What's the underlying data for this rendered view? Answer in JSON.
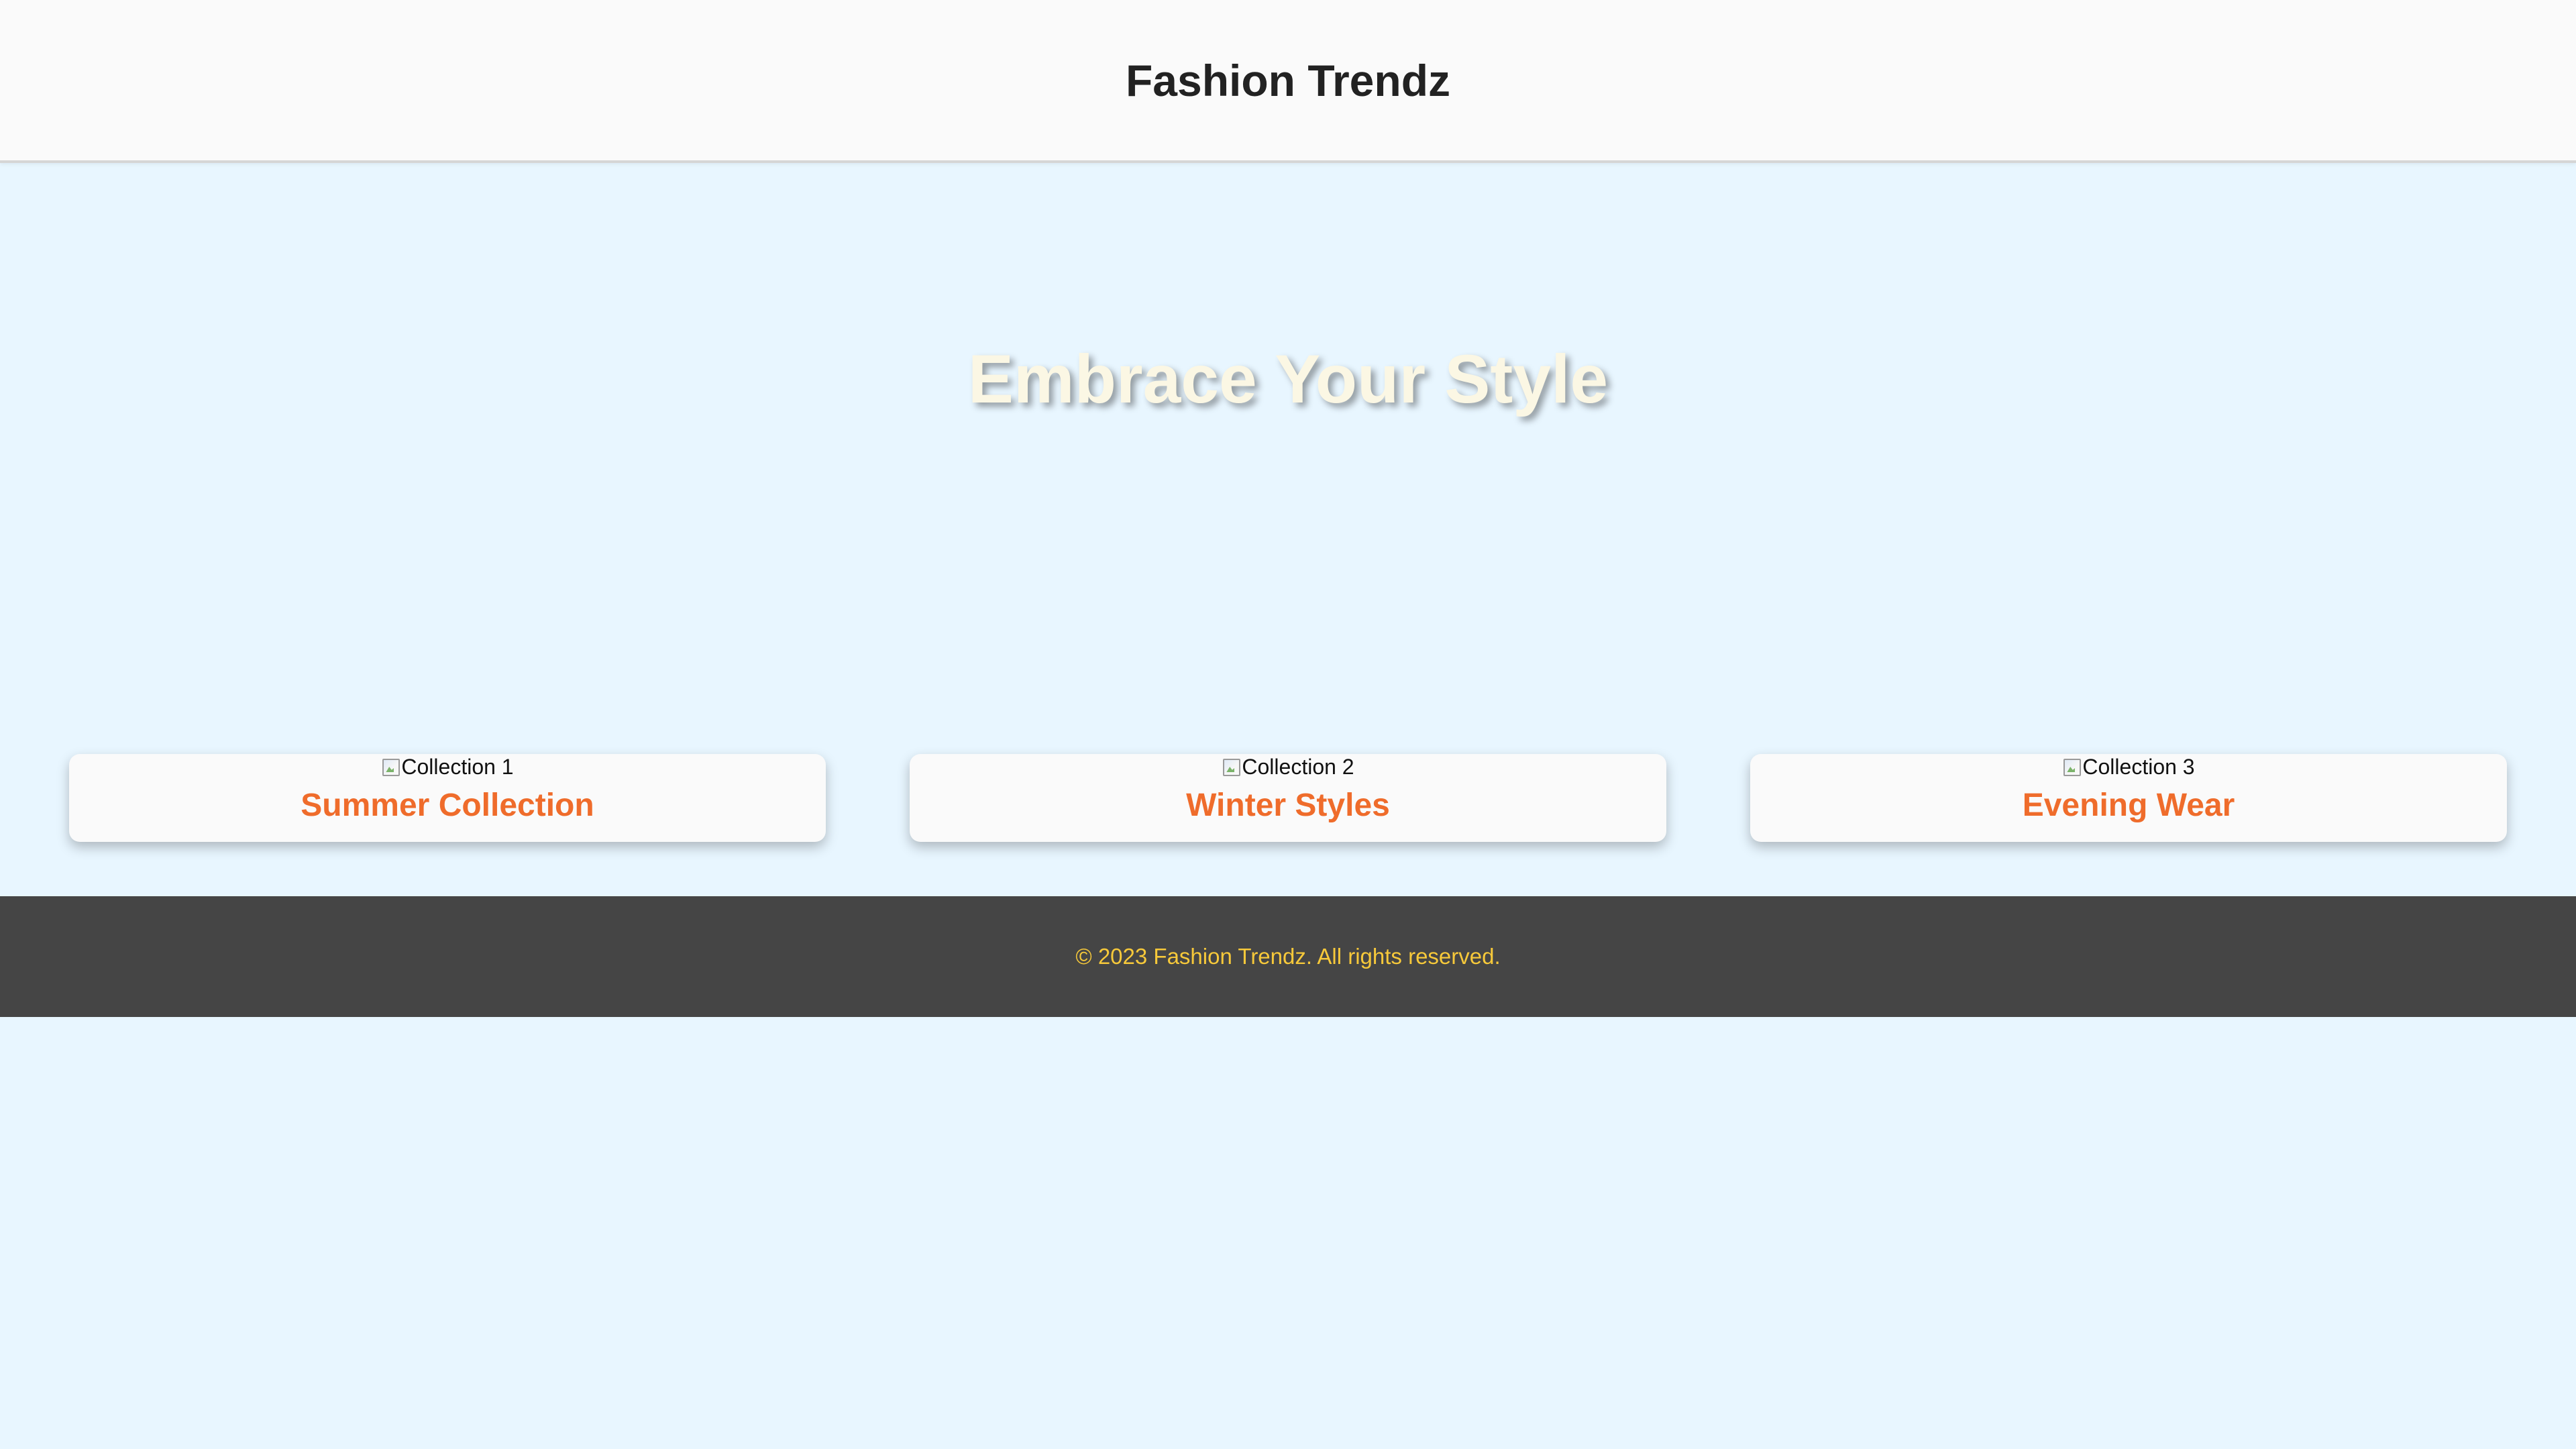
{
  "header": {
    "title": "Fashion Trendz"
  },
  "hero": {
    "title": "Embrace Your Style"
  },
  "collections": [
    {
      "image_alt": "Collection 1",
      "name": "Summer Collection"
    },
    {
      "image_alt": "Collection 2",
      "name": "Winter Styles"
    },
    {
      "image_alt": "Collection 3",
      "name": "Evening Wear"
    }
  ],
  "footer": {
    "text": "© 2023 Fashion Trendz. All rights reserved."
  },
  "colors": {
    "background": "#e8f6ff",
    "header_bg": "#fafafa",
    "hero_text": "#fbf7e4",
    "accent": "#ef6c2b",
    "footer_bg": "#454545",
    "footer_text": "#f7c93a"
  },
  "icons": {
    "collection_image": "broken-image-icon"
  }
}
